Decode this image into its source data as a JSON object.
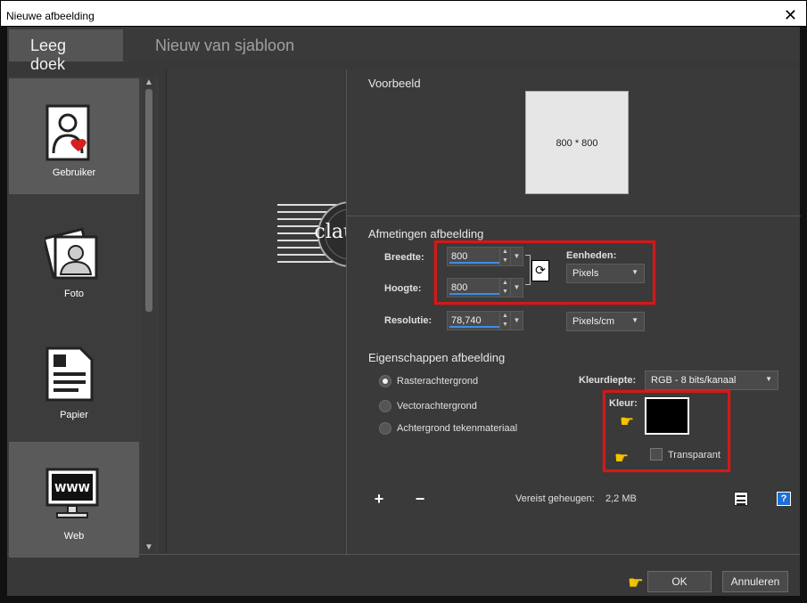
{
  "window": {
    "title": "Nieuwe afbeelding",
    "close_glyph": "✕"
  },
  "tabs": [
    {
      "label": "Leeg doek",
      "active": true
    },
    {
      "label": "Nieuw van sjabloon",
      "active": false
    }
  ],
  "categories": [
    {
      "label": "Gebruiker",
      "icon": "user-icon",
      "selected": true
    },
    {
      "label": "Foto",
      "icon": "photo-icon",
      "selected": false
    },
    {
      "label": "Papier",
      "icon": "paper-icon",
      "selected": false
    },
    {
      "label": "Web",
      "icon": "www-monitor-icon",
      "selected": true
    }
  ],
  "logo_text": "claudia",
  "preview": {
    "title": "Voorbeeld",
    "size_text": "800 * 800"
  },
  "dimensions": {
    "title": "Afmetingen afbeelding",
    "width_label": "Breedte:",
    "width_value": "800",
    "height_label": "Hoogte:",
    "height_value": "800",
    "units_label": "Eenheden:",
    "units_value": "Pixels",
    "resolution_label": "Resolutie:",
    "resolution_value": "78,740",
    "resolution_units": "Pixels/cm"
  },
  "properties": {
    "title": "Eigenschappen afbeelding",
    "raster": "Rasterachtergrond",
    "vector": "Vectorachtergrond",
    "art": "Achtergrond tekenmateriaal",
    "color_depth_label": "Kleurdiepte:",
    "color_depth_value": "RGB - 8 bits/kanaal",
    "color_label": "Kleur:",
    "transparent_label": "Transparant"
  },
  "memory": {
    "label": "Vereist geheugen:",
    "value": "2,2 MB"
  },
  "buttons": {
    "ok": "OK",
    "cancel": "Annuleren",
    "add": "+",
    "remove": "−"
  },
  "colors": {
    "accent": "#3a8ee6",
    "highlight": "#d21919",
    "dialog_bg": "#383838"
  }
}
